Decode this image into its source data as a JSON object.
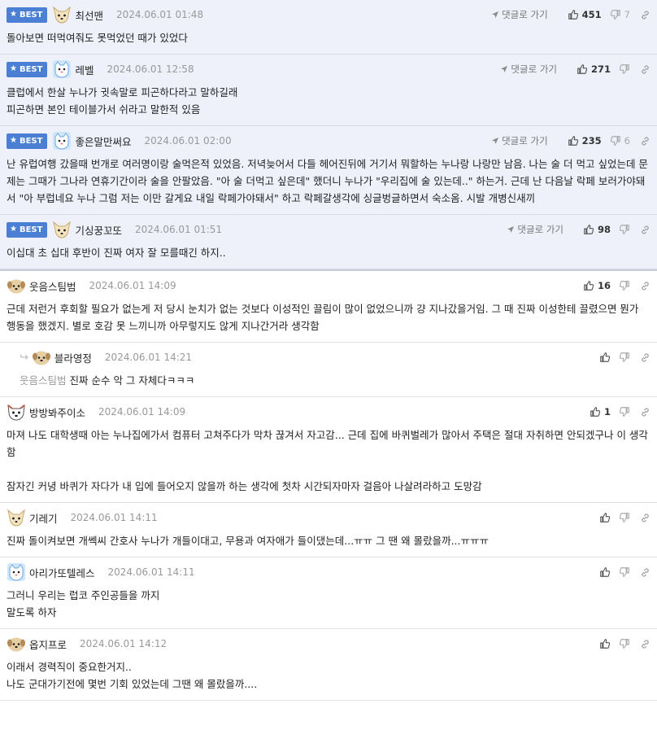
{
  "labels": {
    "best": "BEST",
    "goto_comment": "댓글로 가기"
  },
  "colors": {
    "best_bg": "#eef1f9",
    "badge": "#4a7fd4"
  },
  "comments": [
    {
      "best": true,
      "nick": "최선맨",
      "date": "2024.06.01 01:48",
      "goto": true,
      "up": "451",
      "down": "7",
      "body": "돌아보면 떠먹여줘도 못먹었던 때가 있었다",
      "avatar": "fox-face"
    },
    {
      "best": true,
      "nick": "레벨",
      "date": "2024.06.01 12:58",
      "goto": true,
      "up": "271",
      "down": "",
      "body": "클럽에서 한살 누나가 귓속말로 피곤하다라고 말하길래\n피곤하면 본인 테이블가서 쉬라고 말한적 있음",
      "avatar": "blue-cat-face"
    },
    {
      "best": true,
      "nick": "좋은말만써요",
      "date": "2024.06.01 02:00",
      "goto": true,
      "up": "235",
      "down": "6",
      "body": "난 유럽여행 갔을때 번개로 여러명이랑 술먹은적 있었음. 저녁늦어서 다들 헤어진뒤에 거기서 뭐할하는 누나랑 나랑만 남음. 나는 술 더 먹고 싶었는데 문제는 그때가 그나라 연휴기간이라 술을 안팔았음. \"아 술 더먹고 싶은데\" 했더니 누나가 \"우리집에 술 있는데..\" 하는거. 근데 난 다음날 락페 보러가야돼서 \"아 부럽네요 누나 그럼 저는 이만 갈게요 내일 락페가야돼서\" 하고 락페갈생각에 싱글벙글하면서 숙소옴. 시발 개병신새끼",
      "avatar": "blue-cat-face"
    },
    {
      "best": true,
      "nick": "기싱꿍꼬또",
      "date": "2024.06.01 01:51",
      "goto": true,
      "up": "98",
      "down": "",
      "body": "이십대 초 십대 후반이 진짜 여자 잘 모를때긴 하지..",
      "avatar": "fox-face"
    },
    {
      "best": false,
      "nick": "웃음스팀범",
      "date": "2024.06.01 14:09",
      "goto": false,
      "up": "16",
      "down": "",
      "body": "근데 저런거 후회할 필요가 없는게 저 당시 눈치가 없는 것보다 이성적인 끌림이 많이 없었으니까 걍 지나갔을거임. 그 때 진짜 이성한테 끌렸으면 뭔가 행동을 했겠지. 별로 호감 못 느끼니까 아무렇지도 않게 지나간거라 생각함",
      "avatar": "puppy-face"
    },
    {
      "best": false,
      "reply": true,
      "nick": "블라영정",
      "date": "2024.06.01 14:21",
      "goto": false,
      "up": "",
      "down": "",
      "mention": "웃음스팀범",
      "body": "진짜 순수 악 그 자체다ㅋㅋㅋ",
      "avatar": "puppy-face"
    },
    {
      "best": false,
      "nick": "방방봐주이소",
      "date": "2024.06.01 14:09",
      "goto": false,
      "up": "1",
      "down": "",
      "body": "마져 나도 대학생때 아는 누나집에가서 컴퓨터 고쳐주다가 막차 끊겨서 자고감... 근데 집에 바퀴벌레가 많아서 주택은 절대 자취하면 안되겠구나 이 생각함\n\n잠자긴 커녕 바퀴가 자다가 내 입에 들어오지 않을까 하는 생각에 첫차 시간되자마자 걸음아 나살려라하고 도망감",
      "avatar": "shiba-face"
    },
    {
      "best": false,
      "nick": "기레기",
      "date": "2024.06.01 14:11",
      "goto": false,
      "up": "",
      "down": "",
      "body": "진짜 돌이켜보면 개쎅씨 간호사 누나가 개들이대고, 무용과 여자애가 들이댔는데...ㅠㅠ 그 땐 왜 몰랐을까...ㅠㅠㅠ",
      "avatar": "fox-face"
    },
    {
      "best": false,
      "nick": "아리가또텔레스",
      "date": "2024.06.01 14:11",
      "goto": false,
      "up": "",
      "down": "",
      "body": "그러니 우리는 럽코 주인공들을 까지\n말도록 하자",
      "avatar": "blue-cat-face"
    },
    {
      "best": false,
      "nick": "옵지프로",
      "date": "2024.06.01 14:12",
      "goto": false,
      "up": "",
      "down": "",
      "body": "이래서 경력직이 중요한거지..\n나도 군대가기전에 몇번 기회 있었는데 그땐 왜 몰랐을까....",
      "avatar": "puppy-face"
    }
  ]
}
